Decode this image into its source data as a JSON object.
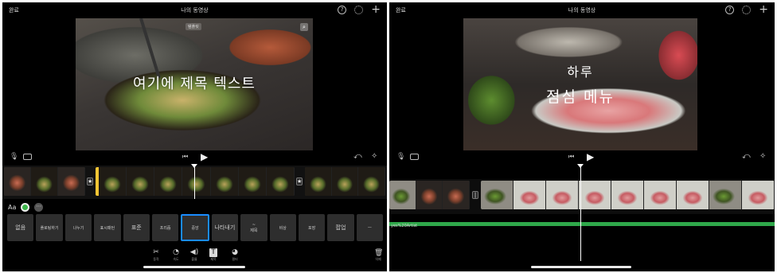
{
  "colors": {
    "accent_blue": "#1a8cff",
    "clip_select_yellow": "#f4c534",
    "audio_green": "#2fa84a",
    "background": "#000000"
  },
  "left": {
    "topbar": {
      "done_label": "완료",
      "title": "나의 동영상",
      "help_icon": "?"
    },
    "viewer": {
      "badge": "템플릿",
      "magnify_icon": "magnifier-icon",
      "title_text": "여기에 제목 텍스트"
    },
    "controls": {
      "mic_icon": "mic-icon",
      "camera_icon": "camera-icon",
      "skip_back": "⏮",
      "play": "▶",
      "undo": "⤺",
      "wave": "✧"
    },
    "timeline": {
      "transition_icon": "★"
    },
    "style_row": {
      "aa_label": "Aa",
      "more_label": "⋯"
    },
    "presets": [
      {
        "label": "없음",
        "big": true
      },
      {
        "label": "플로팅하기",
        "big": false
      },
      {
        "label": "나누기",
        "big": false
      },
      {
        "label": "표시패턴",
        "big": false
      },
      {
        "label": "표준",
        "big": true
      },
      {
        "label": "프리즘",
        "big": false
      },
      {
        "label": "중앙",
        "big": false
      },
      {
        "label": "나타내기",
        "big": true
      },
      {
        "label": "~\n제목",
        "big": false
      },
      {
        "label": "비상",
        "big": false
      },
      {
        "label": "포장",
        "big": false
      },
      {
        "label": "팝업",
        "big": true
      },
      {
        "label": "—",
        "big": false
      }
    ],
    "tools": [
      {
        "icon": "✂",
        "label": "동작"
      },
      {
        "icon": "◔",
        "label": "속도"
      },
      {
        "icon": "◀)",
        "label": "볼륨"
      },
      {
        "icon": "T",
        "label": "제목"
      },
      {
        "icon": "◕",
        "label": "필터"
      }
    ],
    "trash": {
      "icon": "🗑",
      "label": "삭제"
    }
  },
  "right": {
    "topbar": {
      "done_label": "완료",
      "title": "나의 동영상",
      "help_icon": "?"
    },
    "viewer": {
      "line1": "하루",
      "line2": "점심 메뉴"
    },
    "controls": {
      "mic_icon": "mic-icon",
      "camera_icon": "camera-icon",
      "skip_back": "⏮",
      "play": "▶",
      "undo": "⤺",
      "wave": "✧"
    },
    "timeline": {
      "transition_icon": "|"
    },
    "audio": {
      "label": "yes%20Artist"
    }
  }
}
